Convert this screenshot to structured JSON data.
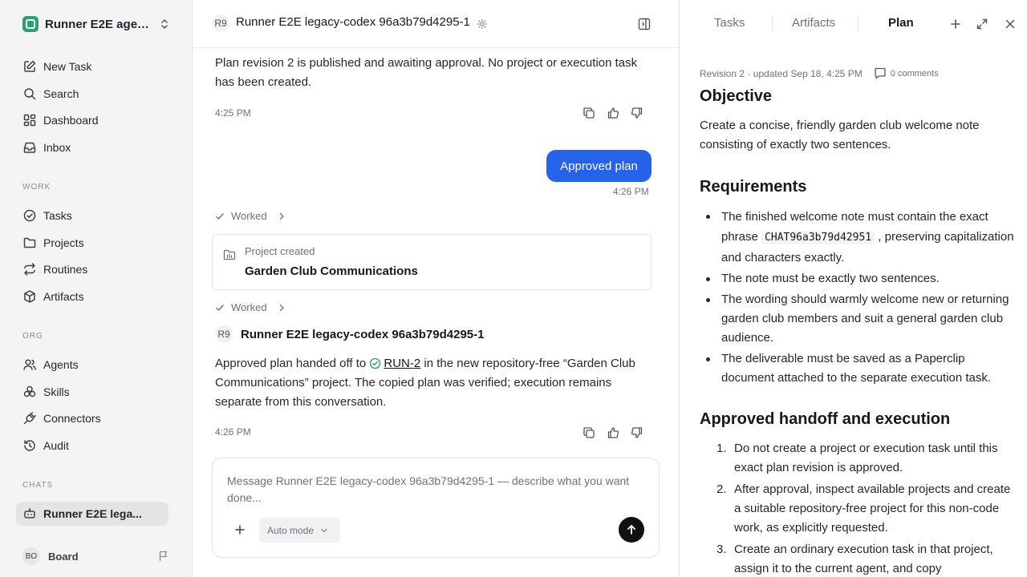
{
  "sidebar": {
    "workspace_name": "Runner E2E agen...",
    "nav": [
      {
        "label": "New Task",
        "icon": "edit-icon"
      },
      {
        "label": "Search",
        "icon": "search-icon"
      },
      {
        "label": "Dashboard",
        "icon": "dashboard-icon"
      },
      {
        "label": "Inbox",
        "icon": "inbox-icon"
      }
    ],
    "work_label": "WORK",
    "work": [
      {
        "label": "Tasks",
        "icon": "check-circle-icon"
      },
      {
        "label": "Projects",
        "icon": "folder-icon"
      },
      {
        "label": "Routines",
        "icon": "repeat-icon"
      },
      {
        "label": "Artifacts",
        "icon": "box-icon"
      }
    ],
    "org_label": "ORG",
    "org": [
      {
        "label": "Agents",
        "icon": "users-icon"
      },
      {
        "label": "Skills",
        "icon": "skills-icon"
      },
      {
        "label": "Connectors",
        "icon": "plug-icon"
      },
      {
        "label": "Audit",
        "icon": "history-icon"
      }
    ],
    "chats_label": "CHATS",
    "chats": [
      {
        "label": "Runner E2E lega...",
        "icon": "bot-icon"
      }
    ],
    "board": {
      "initials": "BO",
      "label": "Board"
    }
  },
  "chat": {
    "header": {
      "avatar": "R9",
      "title": "Runner E2E legacy-codex 96a3b79d4295-1"
    },
    "msg1": {
      "text": "Plan revision 2 is published and awaiting approval. No project or execution task has been created.",
      "time": "4:25 PM"
    },
    "user_msg": {
      "text": "Approved plan",
      "time": "4:26 PM"
    },
    "worked_label": "Worked",
    "project_card": {
      "kicker": "Project created",
      "name": "Garden Club Communications"
    },
    "agent": {
      "avatar": "R9",
      "name": "Runner E2E legacy-codex 96a3b79d4295-1"
    },
    "msg2": {
      "before": "Approved plan handed off to ",
      "link": "RUN-2",
      "after": " in the new repository-free “Garden Club Communications” project. The copied plan was verified; execution remains separate from this conversation.",
      "time": "4:26 PM"
    },
    "composer": {
      "placeholder": "Message Runner E2E legacy-codex 96a3b79d4295-1 — describe what you want done...",
      "mode": "Auto mode"
    }
  },
  "panel": {
    "tabs": [
      "Tasks",
      "Artifacts",
      "Plan"
    ],
    "active_tab": "Plan",
    "meta": "Revision 2 · updated Sep 18, 4:25 PM",
    "comments": "0 comments",
    "objective_title": "Objective",
    "objective_text": "Create a concise, friendly garden club welcome note consisting of exactly two sentences.",
    "requirements_title": "Requirements",
    "req1_before": "The finished welcome note must contain the exact phrase ",
    "req1_code": "CHAT96a3b79d42951",
    "req1_after": " , preserving capitalization and characters exactly.",
    "req2": "The note must be exactly two sentences.",
    "req3": "The wording should warmly welcome new or returning garden club members and suit a general garden club audience.",
    "req4": "The deliverable must be saved as a Paperclip document attached to the separate execution task.",
    "handoff_title": "Approved handoff and execution",
    "steps": [
      "Do not create a project or execution task until this exact plan revision is approved.",
      "After approval, inspect available projects and create a suitable repository-free project for this non-code work, as explicitly requested.",
      "Create an ordinary execution task in that project, assign it to the current agent, and copy"
    ]
  }
}
